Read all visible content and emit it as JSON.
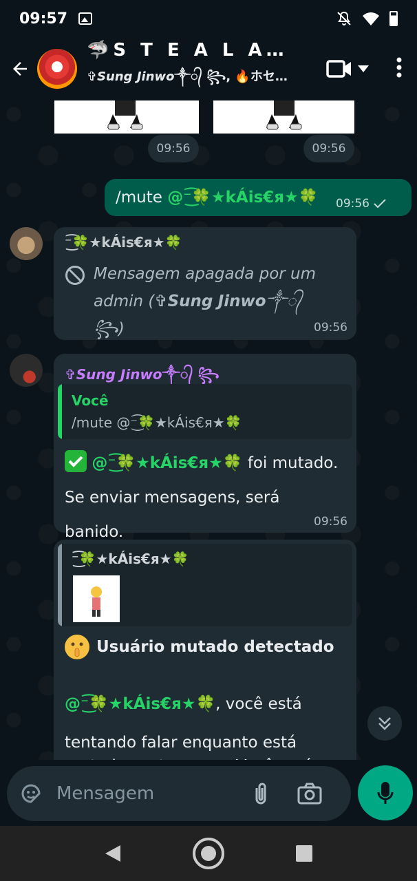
{
  "status_bar": {
    "time": "09:57"
  },
  "header": {
    "title": "🦈S T E A L A B R…",
    "subtitle": "✞𝙎𝙪𝙣𝙜 𝙅𝙞𝙣𝙬𝙤༒᭄ ꧂, 🔥ホセ・…"
  },
  "messages": {
    "image_times": [
      "09:56",
      "09:56"
    ],
    "outgoing": {
      "text": "/mute ",
      "mention": "@⁻͜͡🍀★kÁis€я★🍀",
      "time": "09:56"
    },
    "deleted": {
      "sender": "⁻͜͡🍀★kÁis€я★🍀",
      "text": "Mensagem apagada por um admin (✞𝙎𝙪𝙣𝙜 𝙅𝙞𝙣𝙬𝙤༒᭄ ꧂)",
      "time": "09:56"
    },
    "reply_bot": {
      "sender": "✞𝙎𝙪𝙣𝙜 𝙅𝙞𝙣𝙬𝙤༒᭄ ꧂",
      "quote_author": "Você",
      "quote_text": "/mute @⁻͜͡🍀★kÁis€я★🍀",
      "mention": "@⁻͜͡🍀★kÁis€я★🍀",
      "text_tail": " foi mutado. Se enviar mensagens, será banido.",
      "time": "09:56"
    },
    "detected": {
      "quote_author": "⁻͜͡🍀★kÁis€я★🍀",
      "heading": "Usuário mutado detectado",
      "mention": "@⁻͜͡🍀★kÁis€я★🍀",
      "text_tail": ", você está",
      "line2": "tentando falar enquanto está",
      "line3": "mutado neste grupo. Você será"
    }
  },
  "input": {
    "placeholder": "Mensagem"
  },
  "colors": {
    "background": "#0b141a",
    "bubble_out": "#005c4b",
    "bubble_in": "#202c33",
    "accent": "#00a884",
    "mention": "#25d366",
    "sender_purple": "#c77dff"
  },
  "icons": [
    "back-arrow-icon",
    "video-call-icon",
    "chevron-down-icon",
    "more-vert-icon",
    "ban-icon",
    "check-icon",
    "sticker-icon",
    "attach-icon",
    "camera-icon",
    "mic-icon",
    "scroll-down-icon",
    "nav-back-icon",
    "nav-home-icon",
    "nav-recents-icon"
  ]
}
